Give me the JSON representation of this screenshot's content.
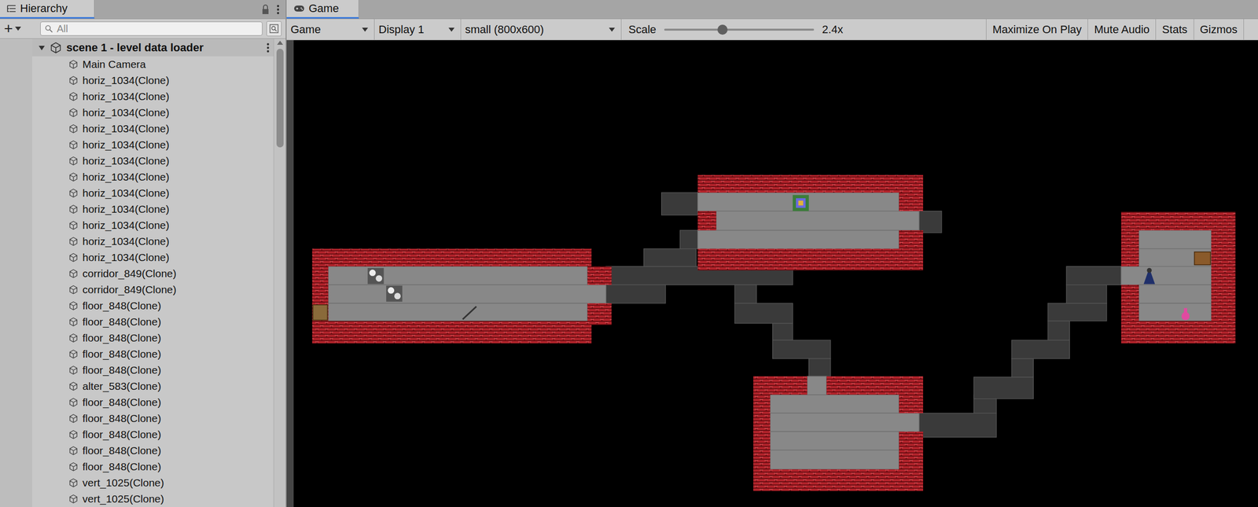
{
  "hierarchy": {
    "tab": "Hierarchy",
    "add_button": "+",
    "search": {
      "placeholder": "All"
    },
    "scene": {
      "name": "scene 1 - level data loader",
      "expanded": true
    },
    "items": [
      "Main Camera",
      "horiz_1034(Clone)",
      "horiz_1034(Clone)",
      "horiz_1034(Clone)",
      "horiz_1034(Clone)",
      "horiz_1034(Clone)",
      "horiz_1034(Clone)",
      "horiz_1034(Clone)",
      "horiz_1034(Clone)",
      "horiz_1034(Clone)",
      "horiz_1034(Clone)",
      "horiz_1034(Clone)",
      "horiz_1034(Clone)",
      "corridor_849(Clone)",
      "corridor_849(Clone)",
      "floor_848(Clone)",
      "floor_848(Clone)",
      "floor_848(Clone)",
      "floor_848(Clone)",
      "floor_848(Clone)",
      "alter_583(Clone)",
      "floor_848(Clone)",
      "floor_848(Clone)",
      "floor_848(Clone)",
      "floor_848(Clone)",
      "floor_848(Clone)",
      "vert_1025(Clone)",
      "vert_1025(Clone)"
    ]
  },
  "game": {
    "tab": "Game",
    "selected": true,
    "toolbar": {
      "view": "Game",
      "display": "Display 1",
      "resolution": "small (800x600)",
      "scale": {
        "label": "Scale",
        "level": 0.39,
        "reading": "2.4x"
      },
      "toggles": [
        {
          "label": "Maximize On Play",
          "on": false
        },
        {
          "label": "Mute Audio",
          "on": false
        },
        {
          "label": "Stats",
          "on": false
        },
        {
          "label": "Gizmos",
          "on": false
        }
      ]
    }
  }
}
